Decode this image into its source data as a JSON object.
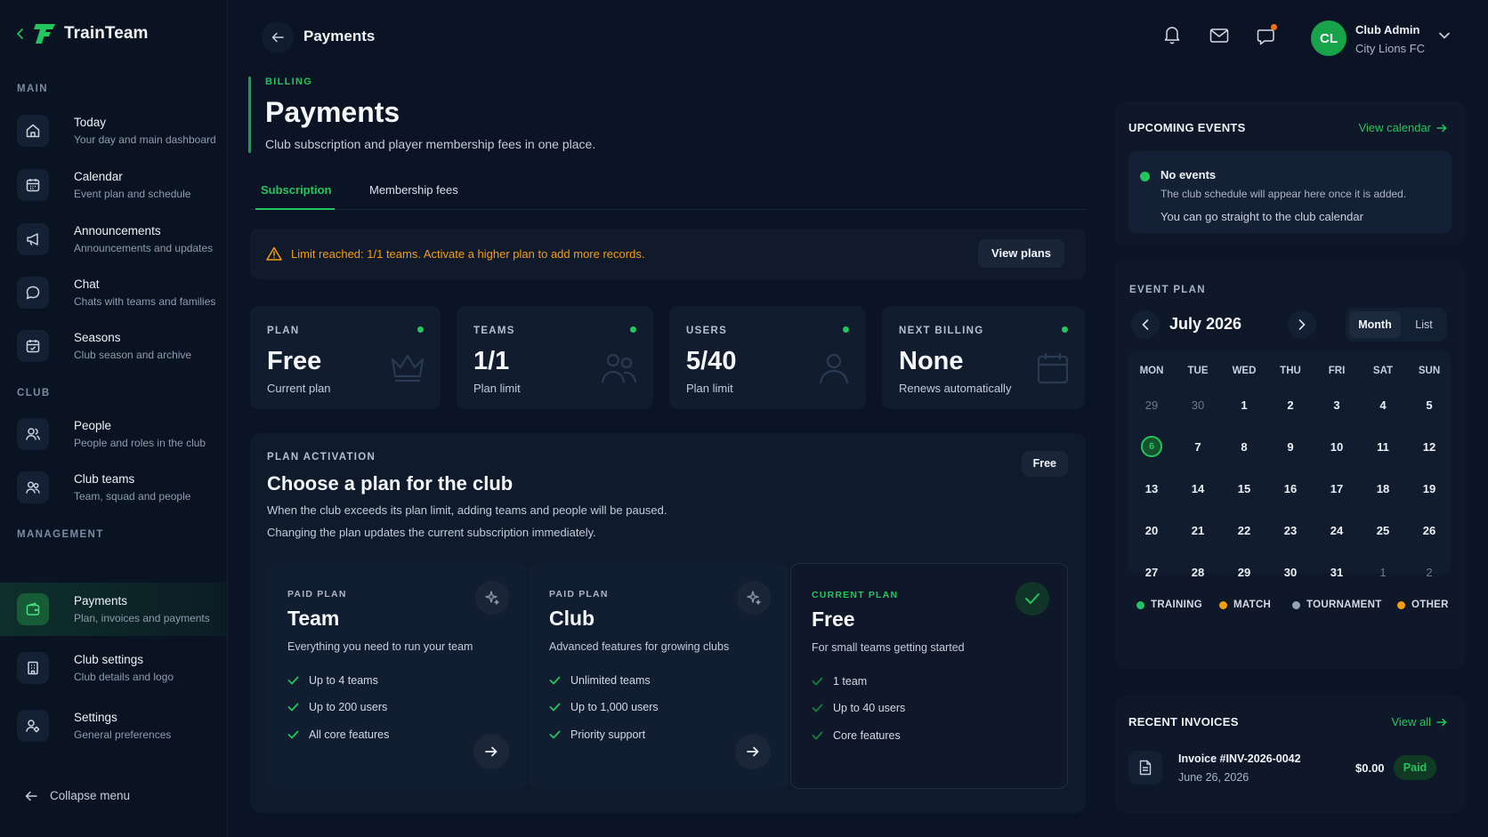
{
  "app": {
    "name": "TrainTeam"
  },
  "sidebar": {
    "sections": [
      "MAIN",
      "CLUB",
      "MANAGEMENT"
    ],
    "items": [
      {
        "title": "Today",
        "sub": "Your day and main dashboard",
        "icon": "home-icon"
      },
      {
        "title": "Calendar",
        "sub": "Event plan and schedule",
        "icon": "calendar-icon"
      },
      {
        "title": "Announcements",
        "sub": "Announcements and updates",
        "icon": "megaphone-icon"
      },
      {
        "title": "Chat",
        "sub": "Chats with teams and families",
        "icon": "chat-icon"
      },
      {
        "title": "Seasons",
        "sub": "Club season and archive",
        "icon": "season-calendar-icon"
      },
      {
        "title": "People",
        "sub": "People and roles in the club",
        "icon": "people-icon"
      },
      {
        "title": "Club teams",
        "sub": "Team, squad and people",
        "icon": "teams-icon"
      },
      {
        "title": "Payments",
        "sub": "Plan, invoices and payments",
        "icon": "wallet-icon"
      },
      {
        "title": "Club settings",
        "sub": "Club details and logo",
        "icon": "building-icon"
      },
      {
        "title": "Settings",
        "sub": "General preferences",
        "icon": "settings-icon"
      }
    ],
    "collapse_label": "Collapse menu"
  },
  "topbar": {
    "title": "Payments",
    "user_initials": "CL",
    "user_name": "Club Admin",
    "user_club": "City Lions FC"
  },
  "page": {
    "kicker": "BILLING",
    "title": "Payments",
    "description": "Club subscription and player membership fees in one place."
  },
  "tabs": [
    "Subscription",
    "Membership fees"
  ],
  "alert": {
    "message": "Limit reached: 1/1 teams. Activate a higher plan to add more records.",
    "button": "View plans"
  },
  "stats": [
    {
      "label": "PLAN",
      "value": "Free",
      "sub": "Current plan"
    },
    {
      "label": "TEAMS",
      "value": "1/1",
      "sub": "Plan limit"
    },
    {
      "label": "USERS",
      "value": "5/40",
      "sub": "Plan limit"
    },
    {
      "label": "NEXT BILLING",
      "value": "None",
      "sub": "Renews automatically"
    }
  ],
  "plan_activation": {
    "kicker": "PLAN ACTIVATION",
    "title": "Choose a plan for the club",
    "desc1": "When the club exceeds its plan limit, adding teams and people will be paused.",
    "desc2": "Changing the plan updates the current subscription immediately.",
    "chip": "Free",
    "plans": [
      {
        "kicker": "PAID PLAN",
        "title": "Team",
        "desc": "Everything you need to run your team",
        "features": [
          "Up to 4 teams",
          "Up to 200 users",
          "All core features"
        ]
      },
      {
        "kicker": "PAID PLAN",
        "title": "Club",
        "desc": "Advanced features for growing clubs",
        "features": [
          "Unlimited teams",
          "Up to 1,000 users",
          "Priority support"
        ]
      },
      {
        "kicker": "CURRENT PLAN",
        "title": "Free",
        "desc": "For small teams getting started",
        "features": [
          "1 team",
          "Up to 40 users",
          "Core features"
        ]
      }
    ]
  },
  "events": {
    "title": "UPCOMING EVENTS",
    "link": "View calendar",
    "empty_title": "No events",
    "empty_sub": "The club schedule will appear here once it is added.",
    "empty_hint": "You can go straight to the club calendar"
  },
  "calendar": {
    "kicker": "EVENT PLAN",
    "month": "July 2026",
    "view_month": "Month",
    "view_list": "List",
    "weekdays": [
      "MON",
      "TUE",
      "WED",
      "THU",
      "FRI",
      "SAT",
      "SUN"
    ],
    "weeks": [
      [
        "29",
        "30",
        "1",
        "2",
        "3",
        "4",
        "5"
      ],
      [
        "6",
        "7",
        "8",
        "9",
        "10",
        "11",
        "12"
      ],
      [
        "13",
        "14",
        "15",
        "16",
        "17",
        "18",
        "19"
      ],
      [
        "20",
        "21",
        "22",
        "23",
        "24",
        "25",
        "26"
      ],
      [
        "27",
        "28",
        "29",
        "30",
        "31",
        "1",
        "2"
      ]
    ],
    "legend": [
      {
        "label": "TRAINING",
        "color": "#22c55e"
      },
      {
        "label": "MATCH",
        "color": "#f59e0b"
      },
      {
        "label": "TOURNAMENT",
        "color": "#94a3b8"
      },
      {
        "label": "OTHER",
        "color": "#f59e0b"
      }
    ]
  },
  "invoices": {
    "title": "RECENT INVOICES",
    "link": "View all",
    "items": [
      {
        "title": "Invoice #INV-2026-0042",
        "date": "June 26, 2026",
        "amount": "$0.00",
        "status": "Paid"
      }
    ]
  },
  "colors": {
    "accent": "#22c55e",
    "warning": "#f59e0b",
    "background": "#0b1424"
  }
}
